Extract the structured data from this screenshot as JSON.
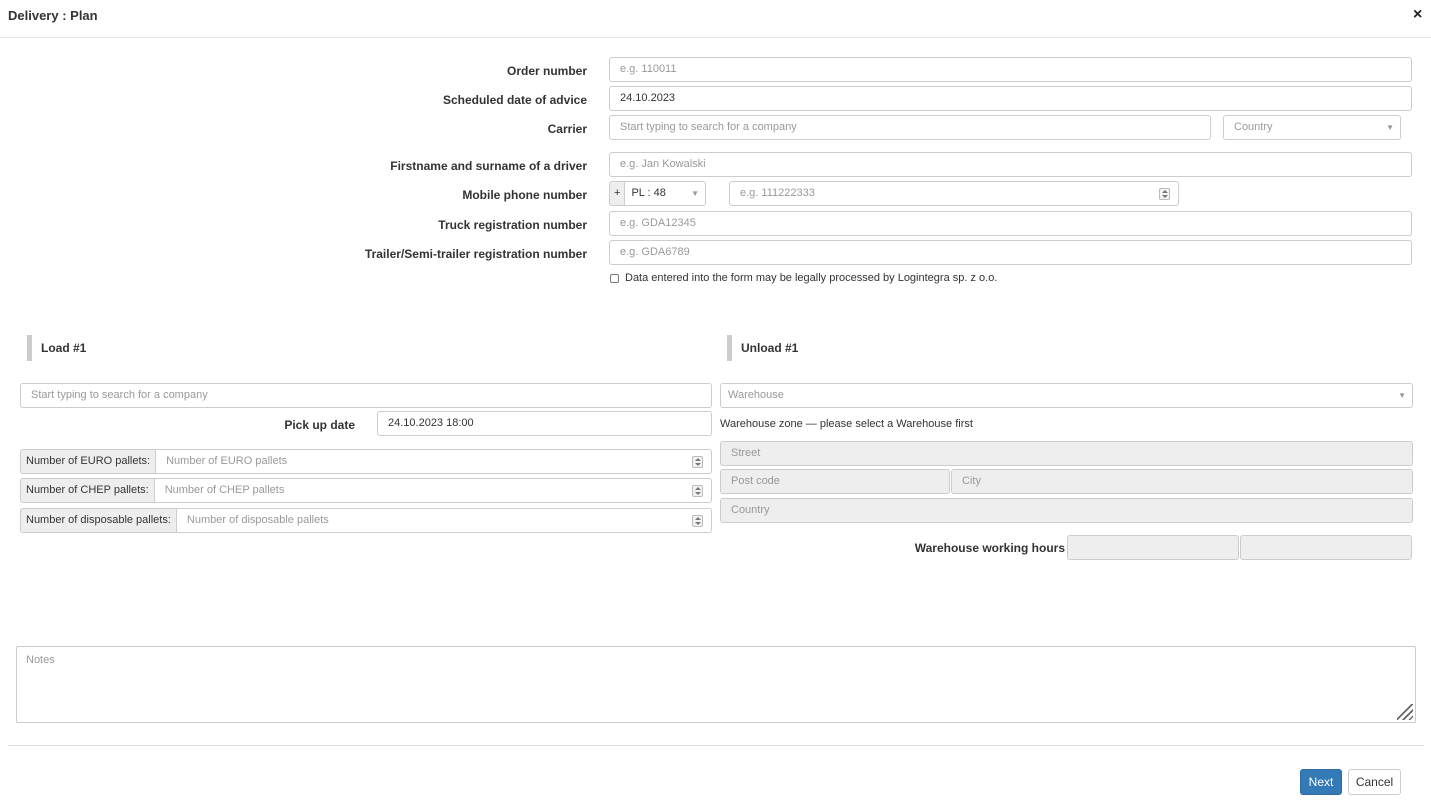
{
  "modal": {
    "title": "Delivery : Plan",
    "close": "×"
  },
  "form": {
    "order_number": {
      "label": "Order number",
      "placeholder": "e.g. 110011"
    },
    "scheduled_date": {
      "label": "Scheduled date of advice",
      "value": "24.10.2023"
    },
    "carrier": {
      "label": "Carrier",
      "placeholder": "Start typing to search for a company",
      "country_placeholder": "Country"
    },
    "driver": {
      "label": "Firstname and surname of a driver",
      "placeholder": "e.g. Jan Kowalski"
    },
    "mobile": {
      "label": "Mobile phone number",
      "plus": "+",
      "prefix": "PL : 48",
      "placeholder": "e.g. 111222333"
    },
    "truck": {
      "label": "Truck registration number",
      "placeholder": "e.g. GDA12345"
    },
    "trailer": {
      "label": "Trailer/Semi-trailer registration number",
      "placeholder": "e.g. GDA6789"
    },
    "consent": "Data entered into the form may be legally processed by Logintegra sp. z o.o."
  },
  "load": {
    "title": "Load #1",
    "company_placeholder": "Start typing to search for a company",
    "pickup_label": "Pick up date",
    "pickup_value": "24.10.2023 18:00",
    "euro": {
      "label": "Number of EURO pallets:",
      "placeholder": "Number of EURO pallets"
    },
    "chep": {
      "label": "Number of CHEP pallets:",
      "placeholder": "Number of CHEP pallets"
    },
    "disposable": {
      "label": "Number of disposable pallets:",
      "placeholder": "Number of disposable pallets"
    }
  },
  "unload": {
    "title": "Unload #1",
    "warehouse_placeholder": "Warehouse",
    "zone_text": "Warehouse zone — please select a Warehouse first",
    "street": "Street",
    "post_code": "Post code",
    "city": "City",
    "country": "Country",
    "hours_label": "Warehouse working hours"
  },
  "notes": {
    "placeholder": "Notes"
  },
  "buttons": {
    "next": "Next",
    "cancel": "Cancel"
  },
  "colors": {
    "primary": "#337ab7",
    "disabled_bg": "#eeeeee",
    "border": "#cccccc"
  }
}
